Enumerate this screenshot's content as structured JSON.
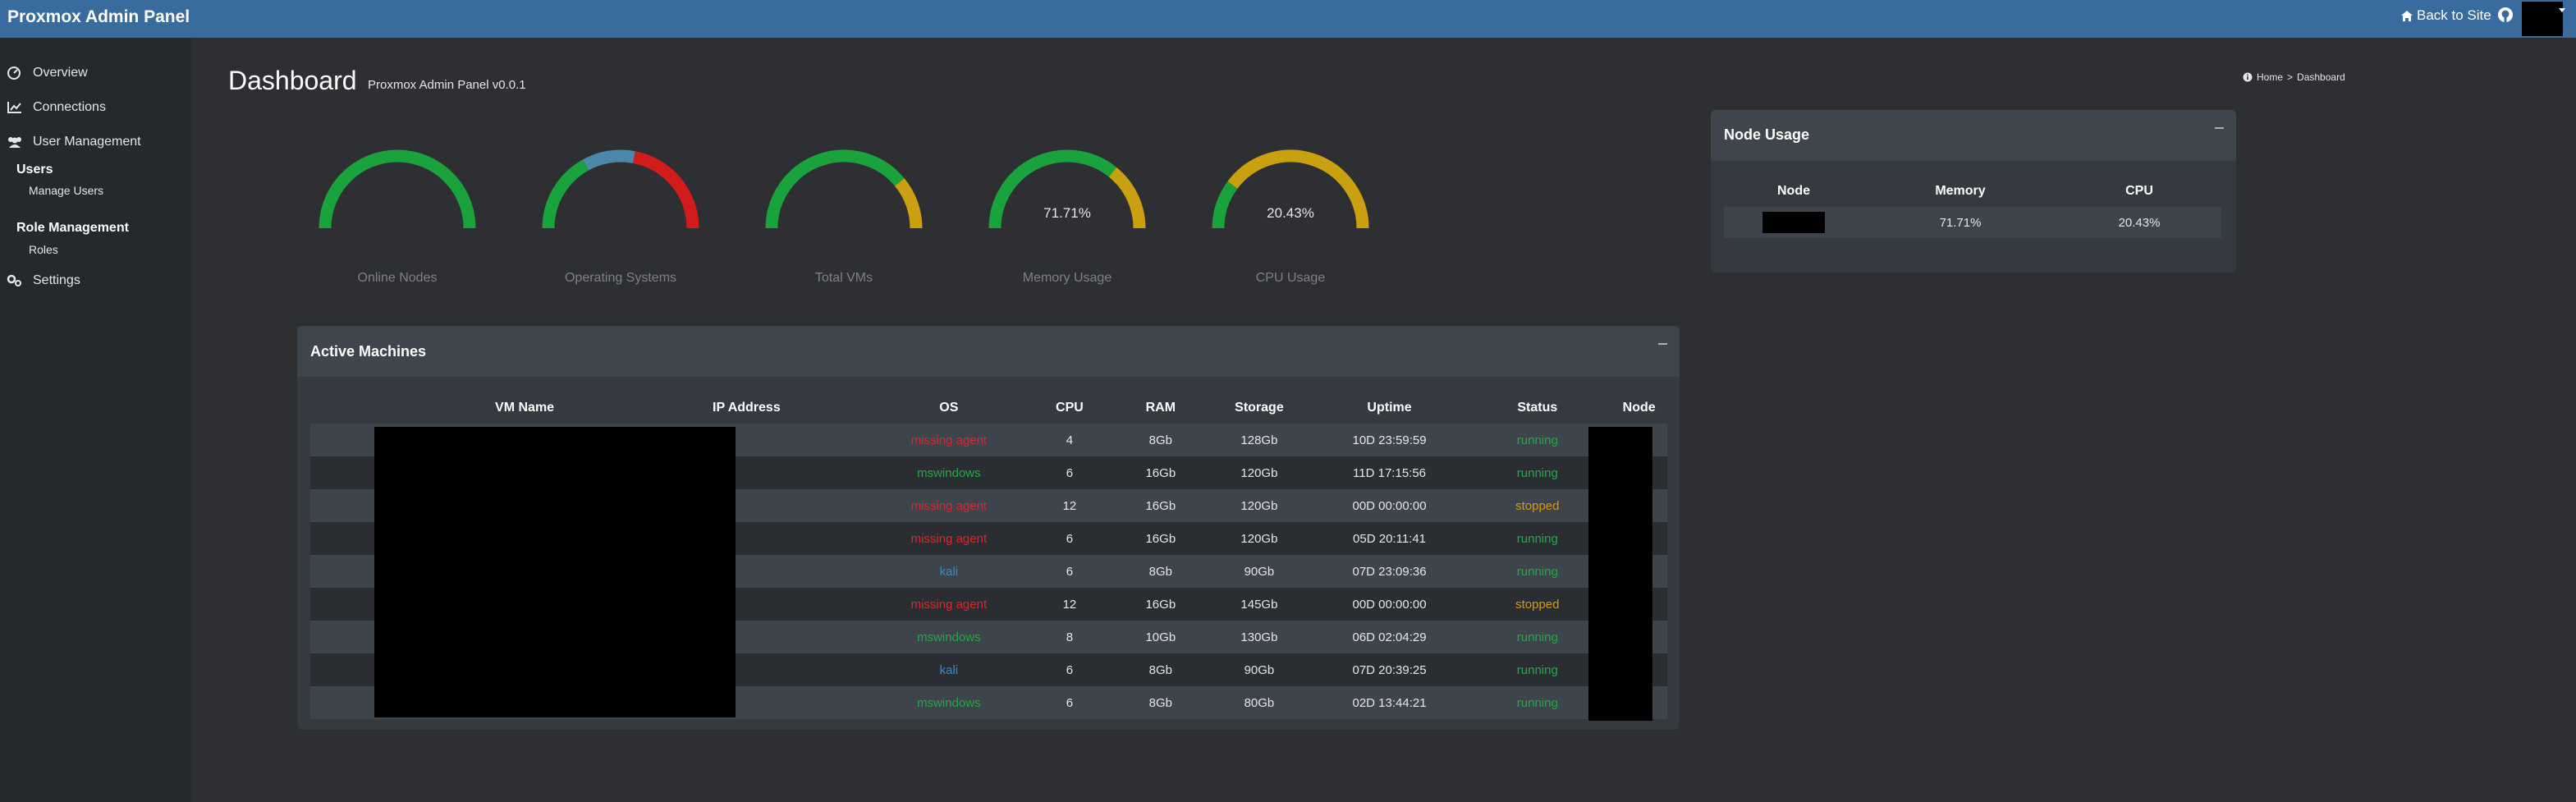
{
  "header": {
    "brand": "Proxmox Admin Panel",
    "back_link": "Back to Site"
  },
  "sidebar": {
    "overview": "Overview",
    "connections": "Connections",
    "user_management": "User Management",
    "users_heading": "Users",
    "manage_users": "Manage Users",
    "role_management_heading": "Role Management",
    "roles": "Roles",
    "settings": "Settings"
  },
  "page": {
    "title": "Dashboard",
    "subtitle": "Proxmox Admin Panel v0.0.1"
  },
  "breadcrumb": {
    "home": "Home",
    "separator": ">",
    "current": "Dashboard"
  },
  "gauges": [
    {
      "label": "Online Nodes",
      "value_text": "",
      "segments": [
        {
          "fraction": 1.0,
          "color": "#1aa23c"
        }
      ]
    },
    {
      "label": "Operating Systems",
      "value_text": "",
      "segments": [
        {
          "fraction": 0.34,
          "color": "#1aa23c"
        },
        {
          "fraction": 0.22,
          "color": "#4a8aa8"
        },
        {
          "fraction": 0.44,
          "color": "#d21c1c"
        }
      ]
    },
    {
      "label": "Total VMs",
      "value_text": "",
      "segments": [
        {
          "fraction": 0.78,
          "color": "#1aa23c"
        },
        {
          "fraction": 0.22,
          "color": "#c9a010"
        }
      ]
    },
    {
      "label": "Memory Usage",
      "value_text": "71.71%",
      "segments": [
        {
          "fraction": 0.7171,
          "color": "#1aa23c"
        },
        {
          "fraction": 0.2829,
          "color": "#c9a010"
        }
      ]
    },
    {
      "label": "CPU Usage",
      "value_text": "20.43%",
      "segments": [
        {
          "fraction": 0.2043,
          "color": "#1aa23c"
        },
        {
          "fraction": 0.7957,
          "color": "#c9a010"
        }
      ]
    }
  ],
  "active_machines": {
    "title": "Active Machines",
    "columns": [
      "VM Name",
      "IP Address",
      "OS",
      "CPU",
      "RAM",
      "Storage",
      "Uptime",
      "Status",
      "Node"
    ],
    "rows": [
      {
        "os": "missing agent",
        "os_class": "os-missing",
        "cpu": "4",
        "ram": "8Gb",
        "storage": "128Gb",
        "uptime": "10D 23:59:59",
        "status": "running",
        "status_class": "st-running"
      },
      {
        "os": "mswindows",
        "os_class": "os-windows",
        "cpu": "6",
        "ram": "16Gb",
        "storage": "120Gb",
        "uptime": "11D 17:15:56",
        "status": "running",
        "status_class": "st-running"
      },
      {
        "os": "missing agent",
        "os_class": "os-missing",
        "cpu": "12",
        "ram": "16Gb",
        "storage": "120Gb",
        "uptime": "00D 00:00:00",
        "status": "stopped",
        "status_class": "st-stopped"
      },
      {
        "os": "missing agent",
        "os_class": "os-missing",
        "cpu": "6",
        "ram": "16Gb",
        "storage": "120Gb",
        "uptime": "05D 20:11:41",
        "status": "running",
        "status_class": "st-running"
      },
      {
        "os": "kali",
        "os_class": "os-kali",
        "cpu": "6",
        "ram": "8Gb",
        "storage": "90Gb",
        "uptime": "07D 23:09:36",
        "status": "running",
        "status_class": "st-running"
      },
      {
        "os": "missing agent",
        "os_class": "os-missing",
        "cpu": "12",
        "ram": "16Gb",
        "storage": "145Gb",
        "uptime": "00D 00:00:00",
        "status": "stopped",
        "status_class": "st-stopped"
      },
      {
        "os": "mswindows",
        "os_class": "os-windows",
        "cpu": "8",
        "ram": "10Gb",
        "storage": "130Gb",
        "uptime": "06D 02:04:29",
        "status": "running",
        "status_class": "st-running"
      },
      {
        "os": "kali",
        "os_class": "os-kali",
        "cpu": "6",
        "ram": "8Gb",
        "storage": "90Gb",
        "uptime": "07D 20:39:25",
        "status": "running",
        "status_class": "st-running"
      },
      {
        "os": "mswindows",
        "os_class": "os-windows",
        "cpu": "6",
        "ram": "8Gb",
        "storage": "80Gb",
        "uptime": "02D 13:44:21",
        "status": "running",
        "status_class": "st-running"
      }
    ]
  },
  "node_usage": {
    "title": "Node Usage",
    "columns": [
      "Node",
      "Memory",
      "CPU"
    ],
    "rows": [
      {
        "memory": "71.71%",
        "cpu": "20.43%"
      }
    ]
  }
}
